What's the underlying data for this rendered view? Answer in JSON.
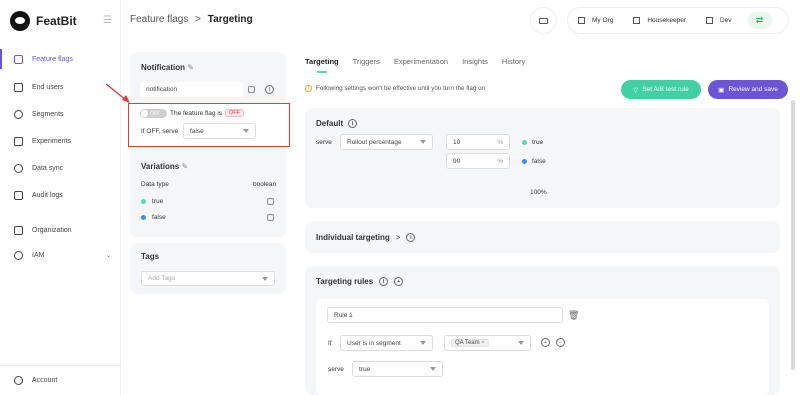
{
  "brand": {
    "name": "FeatBit"
  },
  "nav": {
    "items": [
      {
        "label": "Feature flags"
      },
      {
        "label": "End users"
      },
      {
        "label": "Segments"
      },
      {
        "label": "Experiments"
      },
      {
        "label": "Data sync"
      },
      {
        "label": "Audit logs"
      },
      {
        "label": "Organization"
      },
      {
        "label": "IAM"
      },
      {
        "label": "Account"
      }
    ]
  },
  "header": {
    "crumb_parent": "Feature flags",
    "crumb_sep": ">",
    "crumb_current": "Targeting",
    "org": "My Org",
    "project": "Housekeeper",
    "env": "Dev"
  },
  "left": {
    "notification_title": "Notification",
    "flag_key": "notification",
    "toggle_label": "OFF",
    "flag_status_text": "The feature flag is",
    "flag_status_badge": "OFF",
    "off_serve_label": "If OFF, serve",
    "off_serve_value": "false",
    "variations_title": "Variations",
    "data_type_label": "Data type",
    "data_type_value": "boolean",
    "variations": [
      {
        "name": "true",
        "color": "#5ad6b4"
      },
      {
        "name": "false",
        "color": "#3d8ef0"
      }
    ],
    "tags_title": "Tags",
    "tags_placeholder": "Add Tags"
  },
  "tabs": [
    "Targeting",
    "Triggers",
    "Experimentation",
    "Insights",
    "History"
  ],
  "notice": "Following settings won't be effective until you turn the flag on",
  "actions": {
    "ab_test": "Set A/B test rule",
    "review": "Review and save"
  },
  "default_rule": {
    "title": "Default",
    "serve_label": "serve",
    "serve_mode": "Rollout percentage",
    "rows": [
      {
        "pct": "10",
        "unit": "%",
        "name": "true",
        "color": "#5ad6b4"
      },
      {
        "pct": "90",
        "unit": "%",
        "name": "false",
        "color": "#3d8ef0"
      }
    ],
    "total": "100%"
  },
  "individual": {
    "title": "Individual targeting",
    "chevron": ">"
  },
  "targeting_rules": {
    "title": "Targeting rules",
    "rule_name": "Rule 1",
    "if_label": "If",
    "condition": "User is in segment",
    "segment_tag": "QA Team",
    "serve_label": "serve",
    "serve_value": "true"
  }
}
